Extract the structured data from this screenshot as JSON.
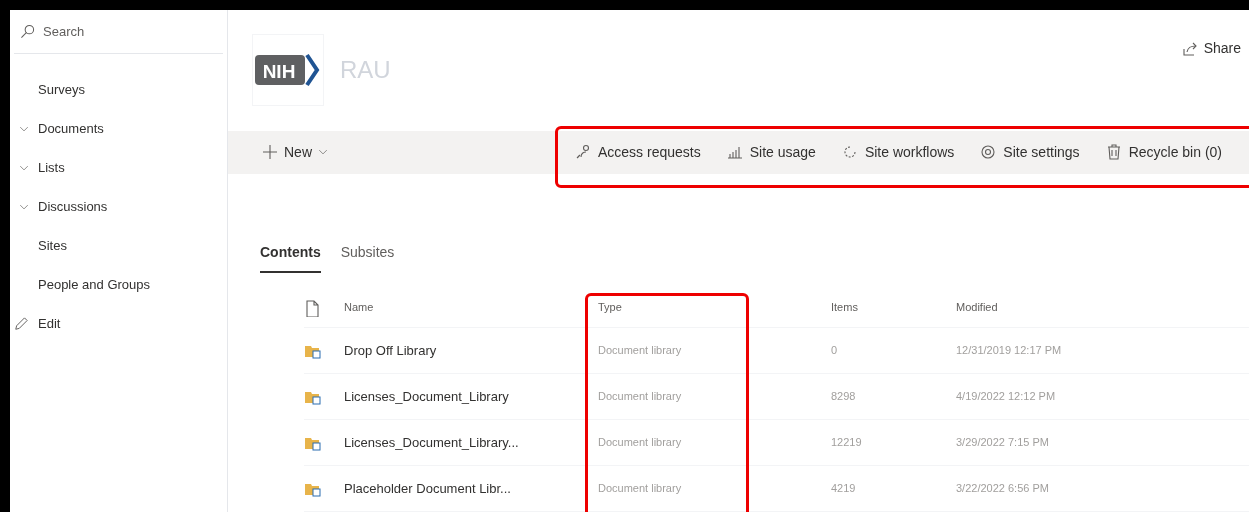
{
  "sidebar": {
    "search": {
      "placeholder": "Search"
    },
    "items": [
      {
        "label": "Surveys",
        "expandable": false
      },
      {
        "label": "Documents",
        "expandable": true
      },
      {
        "label": "Lists",
        "expandable": true
      },
      {
        "label": "Discussions",
        "expandable": true
      },
      {
        "label": "Sites",
        "expandable": false
      },
      {
        "label": "People and Groups",
        "expandable": false
      }
    ],
    "edit": "Edit"
  },
  "header": {
    "logo_text": "NIH",
    "site_title": "RAU",
    "share": "Share"
  },
  "toolbar": {
    "new": "New",
    "actions": [
      {
        "kind": "access",
        "label": "Access requests"
      },
      {
        "kind": "usage",
        "label": "Site usage"
      },
      {
        "kind": "workflows",
        "label": "Site workflows"
      },
      {
        "kind": "settings",
        "label": "Site settings"
      },
      {
        "kind": "recycle",
        "label": "Recycle bin (0)"
      }
    ]
  },
  "tabs": [
    {
      "label": "Contents",
      "selected": true
    },
    {
      "label": "Subsites",
      "selected": false
    }
  ],
  "table": {
    "columns": [
      "Name",
      "Type",
      "Items",
      "Modified"
    ],
    "rows": [
      {
        "name": "Drop Off Library",
        "type": "Document library",
        "items": "0",
        "modified": "12/31/2019 12:17 PM"
      },
      {
        "name": "Licenses_Document_Library",
        "type": "Document library",
        "items": "8298",
        "modified": "4/19/2022 12:12 PM"
      },
      {
        "name": "Licenses_Document_Library...",
        "type": "Document library",
        "items": "12219",
        "modified": "3/29/2022 7:15 PM"
      },
      {
        "name": "Placeholder Document Libr...",
        "type": "Document library",
        "items": "4219",
        "modified": "3/22/2022 6:56 PM"
      }
    ]
  }
}
